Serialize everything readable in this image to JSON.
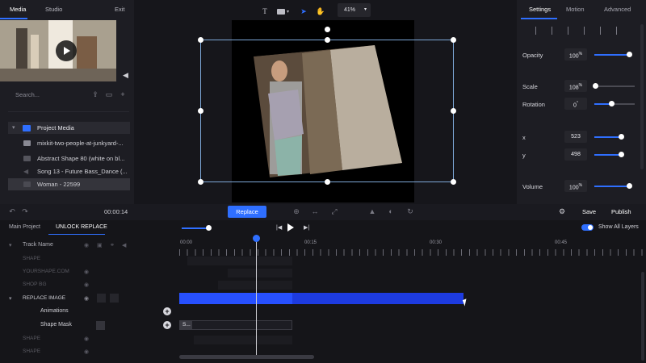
{
  "left_panel": {
    "tabs": [
      {
        "label": "Media",
        "active": true
      },
      {
        "label": "Studio",
        "active": false
      }
    ],
    "exit_label": "Exit",
    "search_placeholder": "Search...",
    "folder": {
      "label": "Project Media",
      "icon": "folder-icon"
    },
    "media_items": [
      {
        "label": "mixkit-two-people-at-junkyard-...",
        "icon": "video-icon"
      },
      {
        "label": "Abstract Shape 80 (white on bl...",
        "icon": "image-icon"
      },
      {
        "label": "Song 13 - Future Bass_Dance (...",
        "icon": "audio-icon"
      },
      {
        "label": "Woman - 22599",
        "icon": "image-icon",
        "selected": true
      }
    ],
    "timecode": "00:00:14"
  },
  "toolbar": {
    "text_tool": "T",
    "zoom": "41%"
  },
  "right_panel": {
    "tabs": [
      {
        "label": "Settings",
        "active": true
      },
      {
        "label": "Motion",
        "active": false
      },
      {
        "label": "Advanced",
        "active": false
      }
    ],
    "properties": [
      {
        "label": "Opacity",
        "value": "100",
        "unit": "%",
        "fraction": 1.0
      },
      {
        "label": "Scale",
        "value": "108",
        "unit": "%",
        "fraction": 0.0
      },
      {
        "label": "Rotation",
        "value": "0",
        "unit": "°",
        "fraction": 0.5
      },
      {
        "label": "x",
        "value": "523",
        "unit": "",
        "fraction": 0.7
      },
      {
        "label": "y",
        "value": "498",
        "unit": "",
        "fraction": 0.7
      },
      {
        "label": "Volume",
        "value": "100",
        "unit": "%",
        "fraction": 1.0
      }
    ]
  },
  "actions": {
    "replace": "Replace",
    "save": "Save",
    "publish": "Publish"
  },
  "timeline": {
    "tabs": [
      {
        "label": "Main Project",
        "active": false
      },
      {
        "label": "UNLOCK REPLACE",
        "active": true
      }
    ],
    "show_all_layers": "Show All Layers",
    "ruler": [
      "00:00",
      "00:15",
      "00:30",
      "00:45"
    ],
    "track_header": "Track Name",
    "tracks": {
      "t1": "SHAPE",
      "t2": "YOURSHAPE.COM",
      "t3": "SHOP BG",
      "replace_image": "REPLACE IMAGE",
      "animations": "Animations",
      "shape_mask": "Shape Mask",
      "t7": "SHAPE",
      "t8": "SHAPE"
    },
    "shape_clip_label": "S..."
  },
  "colors": {
    "accent": "#2f6fff",
    "clip": "#1d3be0",
    "panel": "#1d1d23",
    "background": "#16161b"
  }
}
